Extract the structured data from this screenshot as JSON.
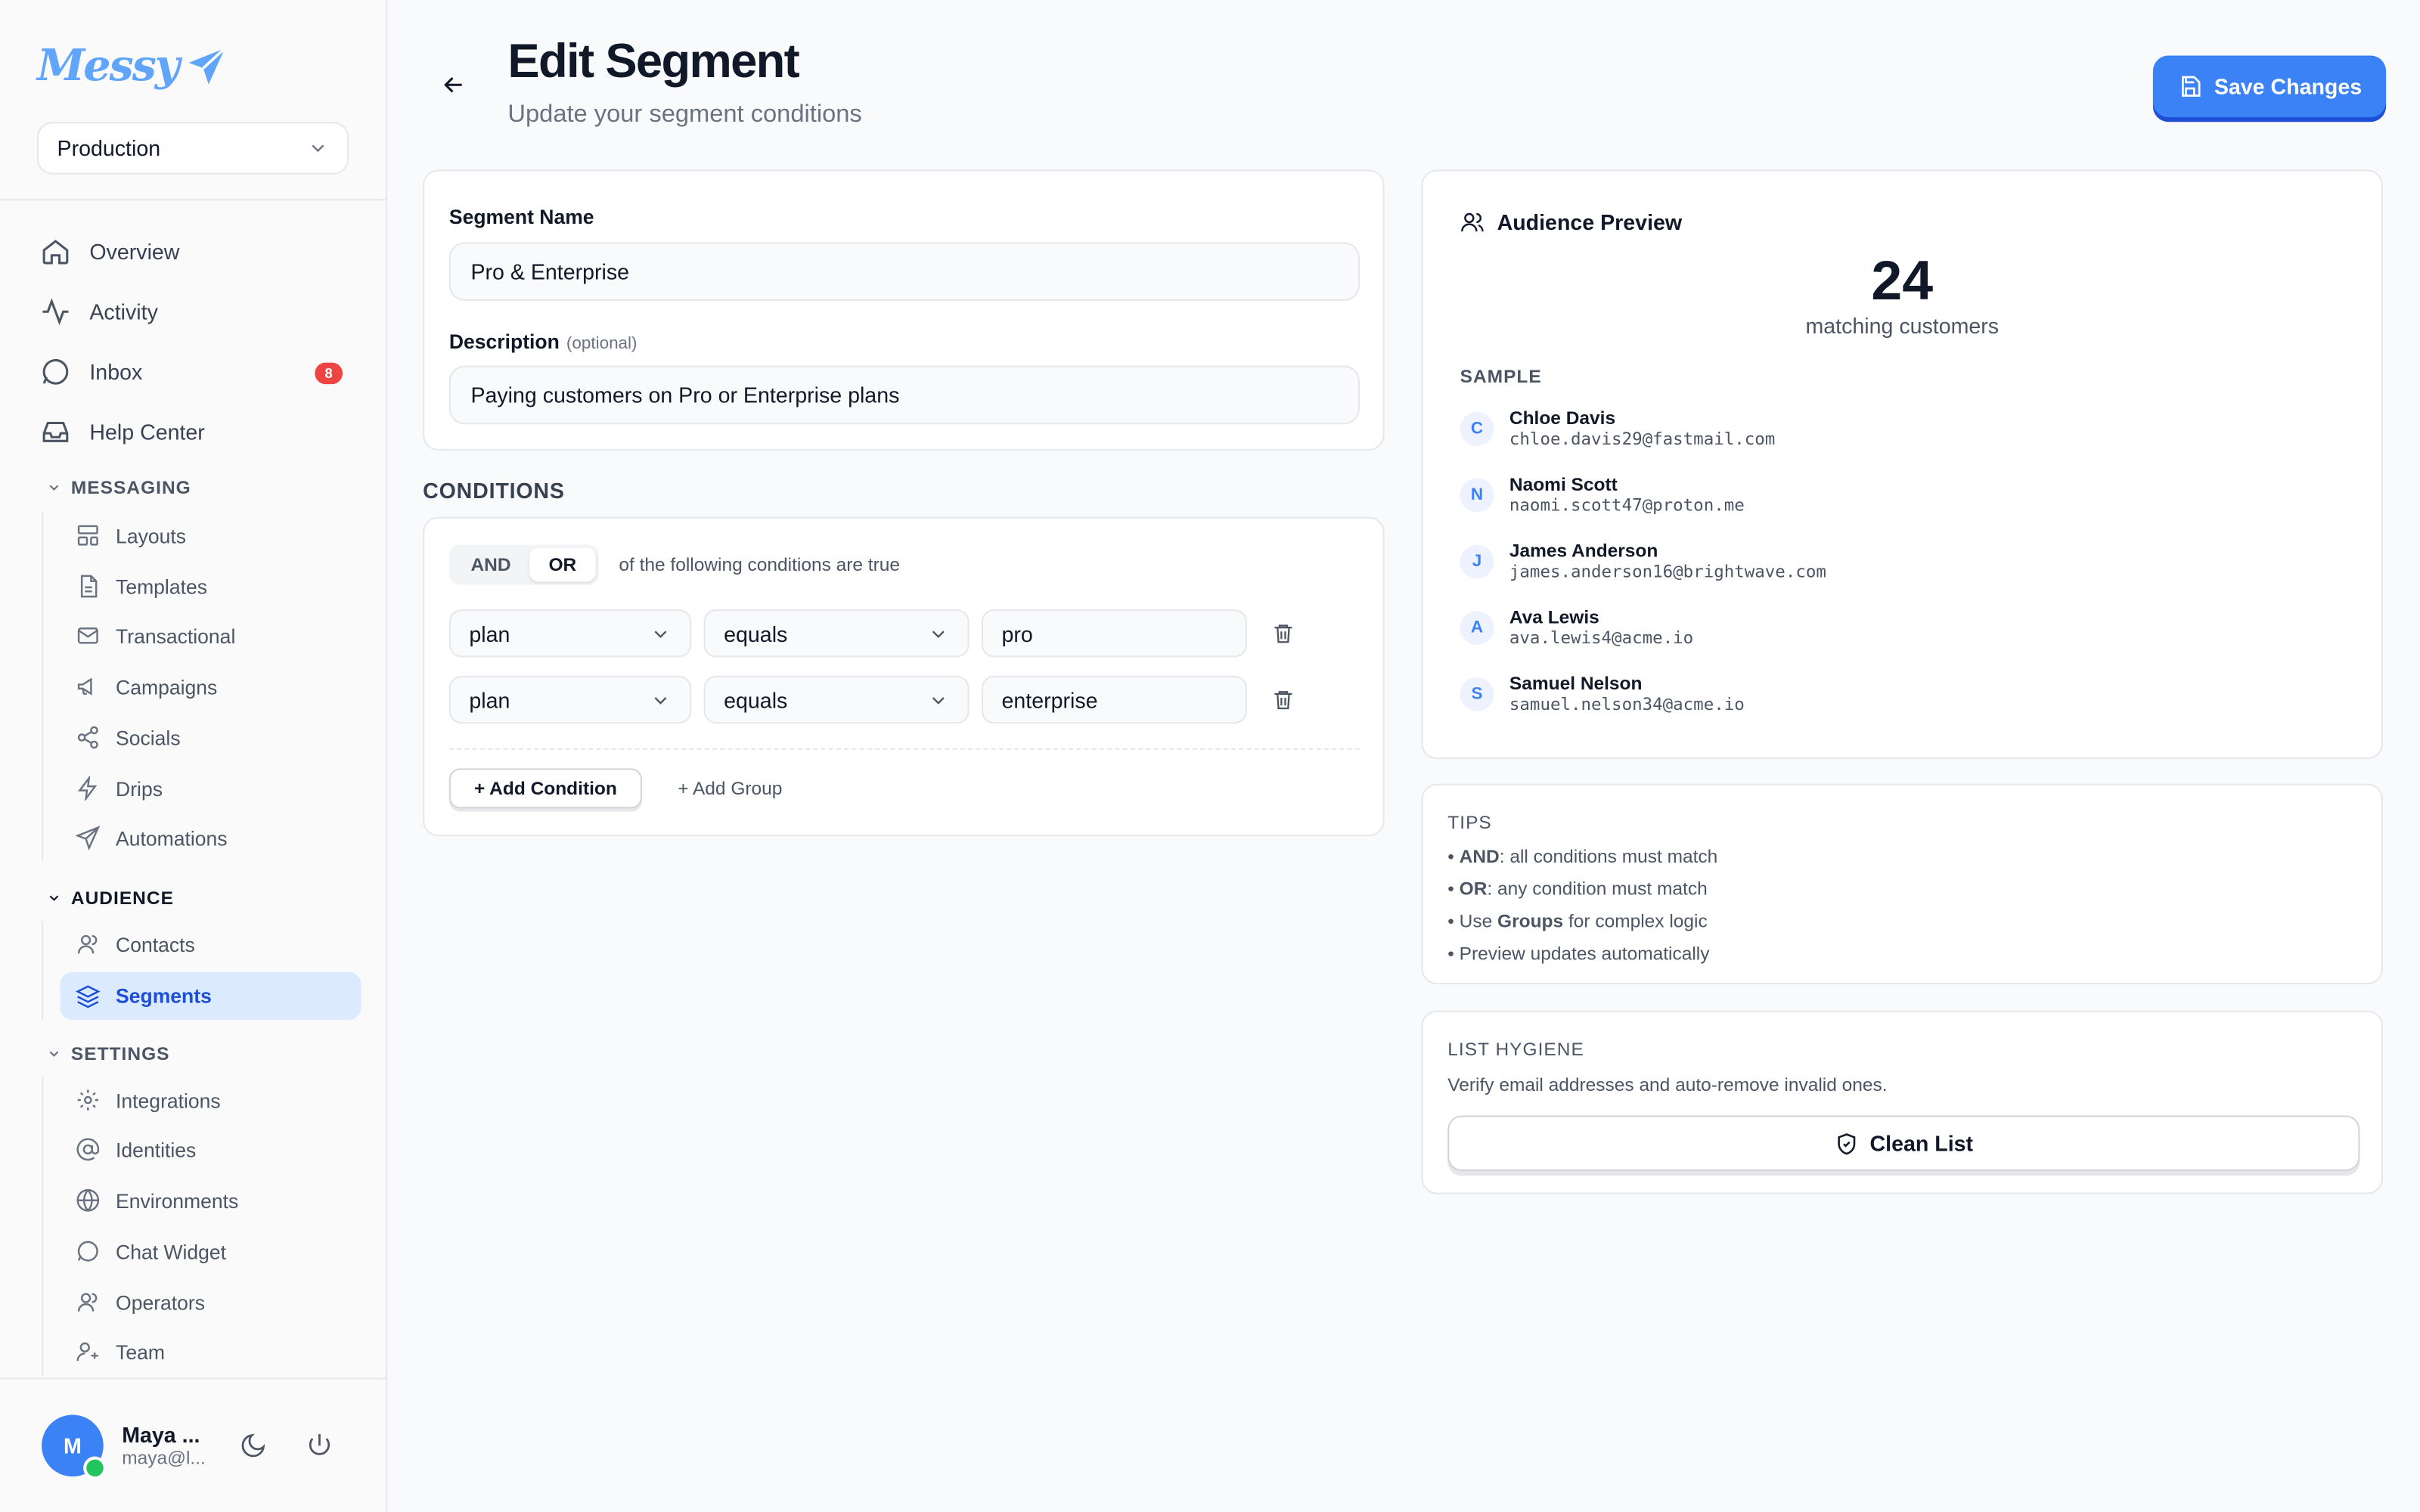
{
  "app": {
    "logo": "Messy",
    "environment": "Production"
  },
  "nav": {
    "overview": "Overview",
    "activity": "Activity",
    "inbox": "Inbox",
    "inbox_badge": "8",
    "help": "Help Center"
  },
  "messaging": {
    "title": "MESSAGING",
    "items": [
      "Layouts",
      "Templates",
      "Transactional",
      "Campaigns",
      "Socials",
      "Drips",
      "Automations"
    ]
  },
  "audience": {
    "title": "AUDIENCE",
    "items": [
      "Contacts",
      "Segments"
    ]
  },
  "settings": {
    "title": "SETTINGS",
    "items": [
      "Integrations",
      "Identities",
      "Environments",
      "Chat Widget",
      "Operators",
      "Team"
    ]
  },
  "user": {
    "initial": "M",
    "name": "Maya ...",
    "email": "maya@l..."
  },
  "header": {
    "title": "Edit Segment",
    "subtitle": "Update your segment conditions",
    "save": "Save Changes"
  },
  "form": {
    "name_label": "Segment Name",
    "name_value": "Pro & Enterprise",
    "desc_label": "Description",
    "desc_optional": "(optional)",
    "desc_value": "Paying customers on Pro or Enterprise plans"
  },
  "conditions": {
    "title": "CONDITIONS",
    "and": "AND",
    "or": "OR",
    "suffix": "of the following conditions are true",
    "rows": [
      {
        "field": "plan",
        "op": "equals",
        "value": "pro"
      },
      {
        "field": "plan",
        "op": "equals",
        "value": "enterprise"
      }
    ],
    "add_condition": "+ Add Condition",
    "add_group": "+ Add Group"
  },
  "preview": {
    "title": "Audience Preview",
    "count": "24",
    "count_label": "matching customers",
    "sample_title": "SAMPLE",
    "sample": [
      {
        "initial": "C",
        "name": "Chloe Davis",
        "email": "chloe.davis29@fastmail.com"
      },
      {
        "initial": "N",
        "name": "Naomi Scott",
        "email": "naomi.scott47@proton.me"
      },
      {
        "initial": "J",
        "name": "James Anderson",
        "email": "james.anderson16@brightwave.com"
      },
      {
        "initial": "A",
        "name": "Ava Lewis",
        "email": "ava.lewis4@acme.io"
      },
      {
        "initial": "S",
        "name": "Samuel Nelson",
        "email": "samuel.nelson34@acme.io"
      }
    ]
  },
  "tips": {
    "title": "TIPS",
    "t1_b": "AND",
    "t1": ": all conditions must match",
    "t2_b": "OR",
    "t2": ": any condition must match",
    "t3_a": "Use ",
    "t3_b": "Groups",
    "t3_c": " for complex logic",
    "t4": "Preview updates automatically"
  },
  "hygiene": {
    "title": "LIST HYGIENE",
    "text": "Verify email addresses and auto-remove invalid ones.",
    "button": "Clean List"
  },
  "colors": {
    "accent": "#3b82f6",
    "badge": "#ef4444",
    "active_bg": "#dbeafe"
  }
}
